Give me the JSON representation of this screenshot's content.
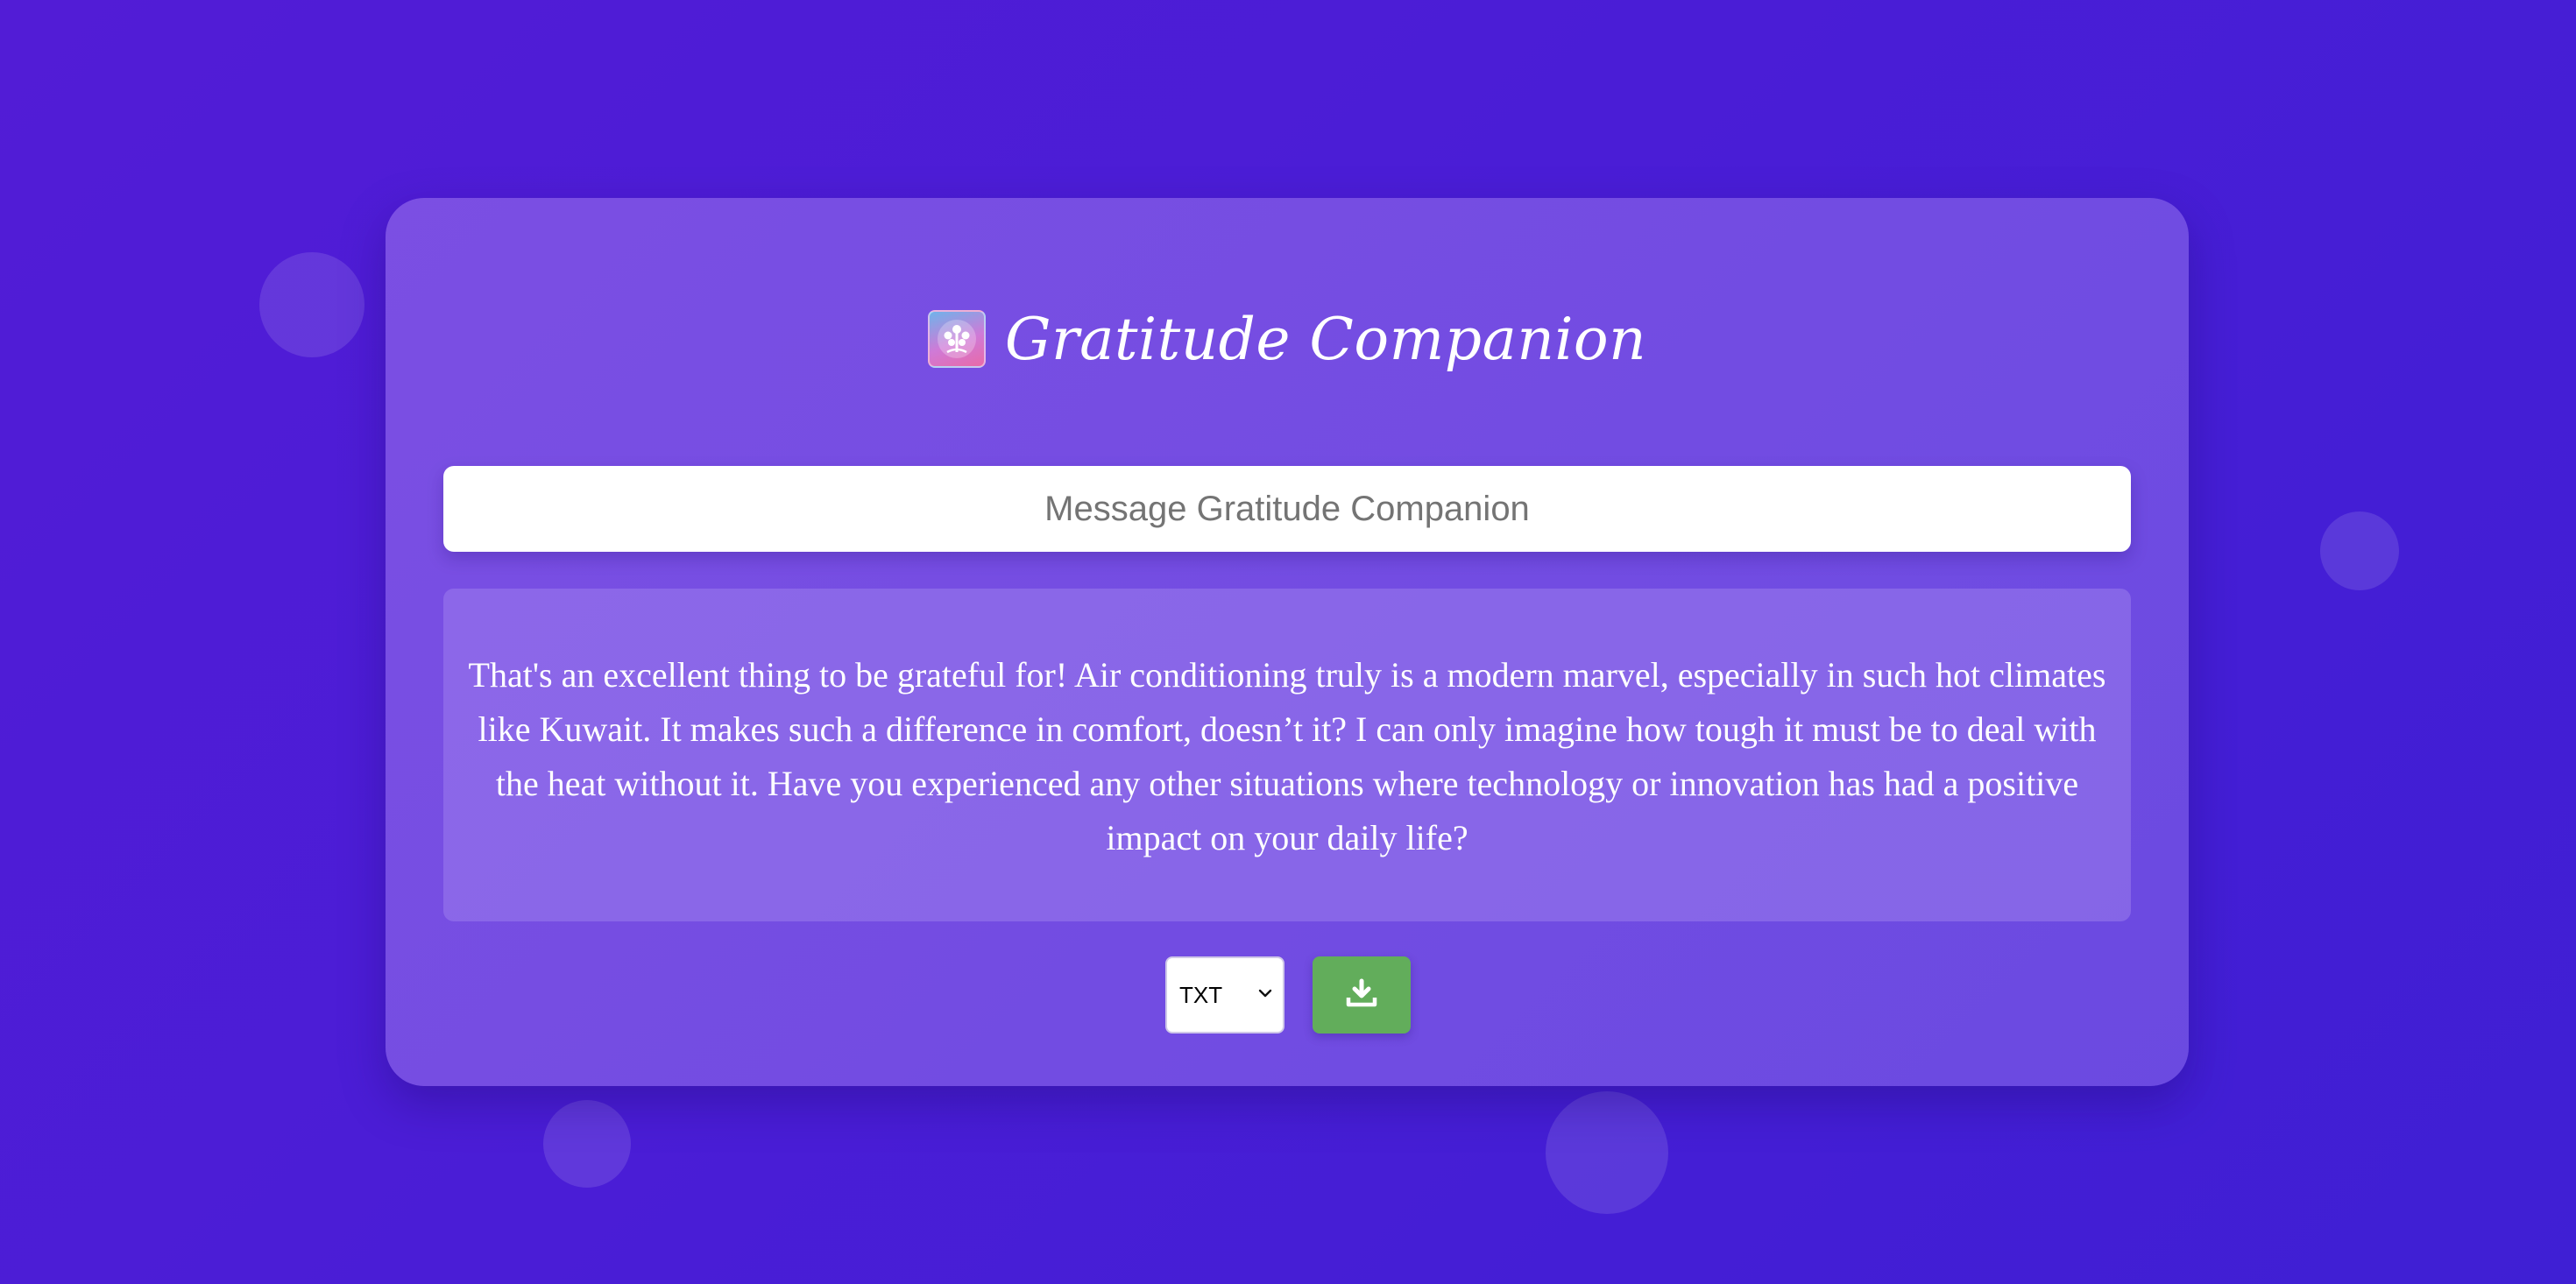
{
  "app": {
    "title": "Gratitude Companion",
    "logo_icon": "tree-logo-icon"
  },
  "input": {
    "placeholder": "Message Gratitude Companion",
    "value": ""
  },
  "response": {
    "text": "That's an excellent thing to be grateful for! Air conditioning truly is a modern marvel, especially in such hot climates like Kuwait. It makes such a difference in comfort, doesn’t it? I can only imagine how tough it must be to deal with the heat without it. Have you experienced any other situations where technology or innovation has had a positive impact on your daily life?"
  },
  "controls": {
    "format_selected": "TXT",
    "download_icon": "download-icon"
  },
  "colors": {
    "background": "#4a1dd6",
    "download_button": "#62ad5b"
  }
}
